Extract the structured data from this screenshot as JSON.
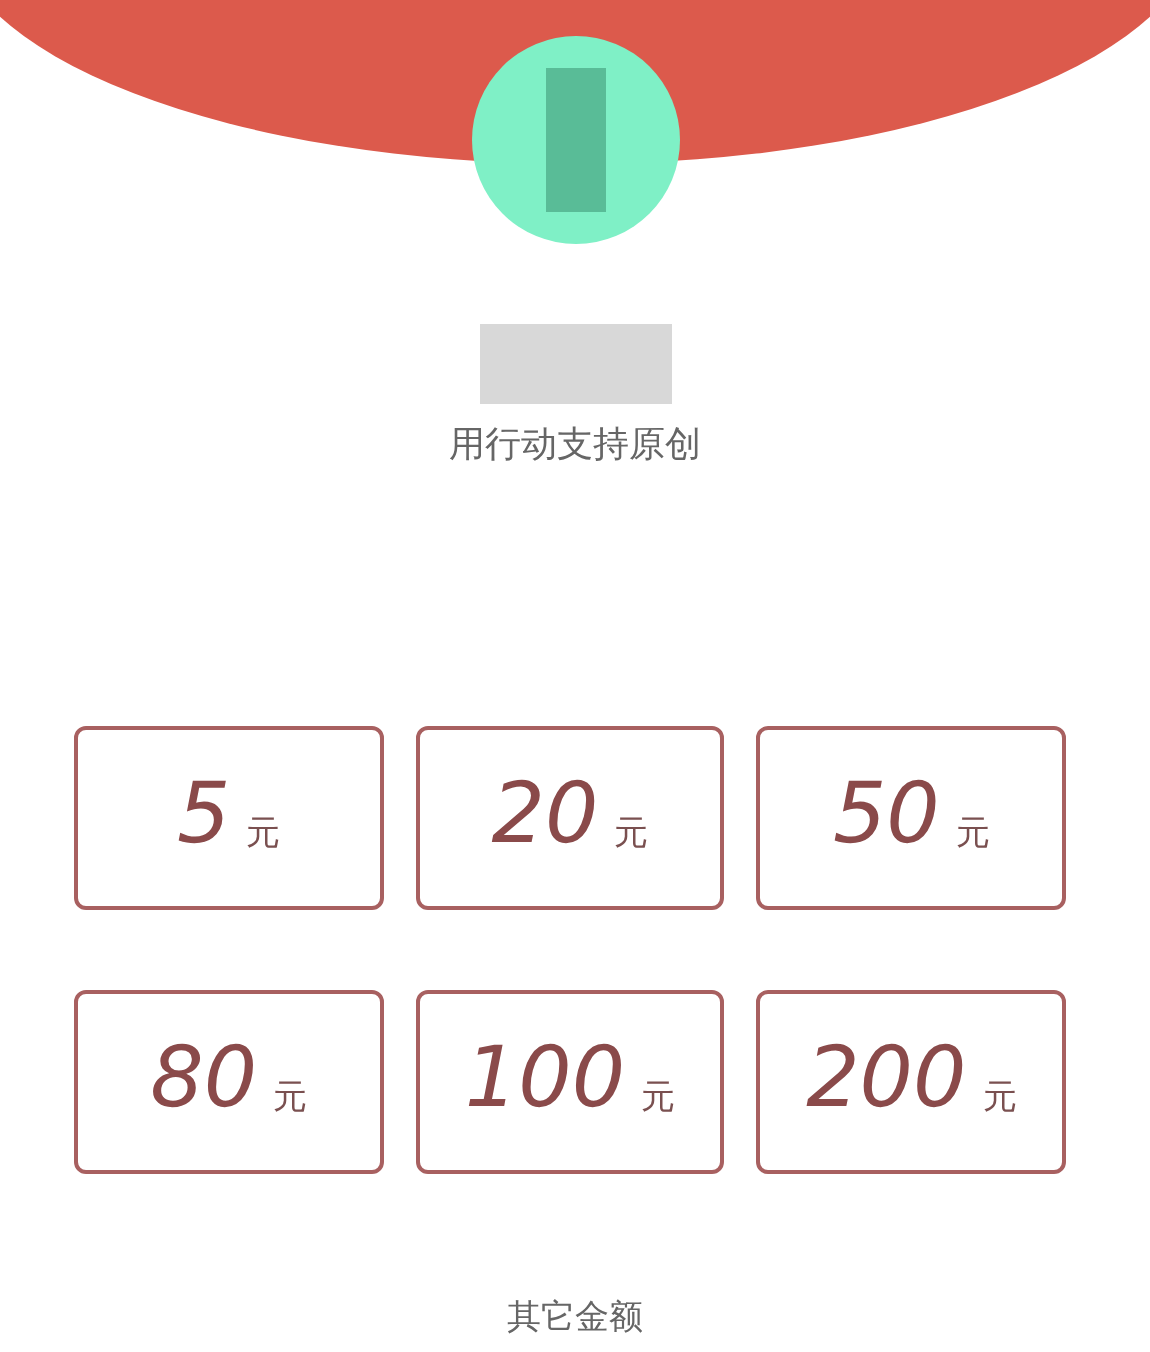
{
  "slogan": "用行动支持原创",
  "amounts": [
    {
      "value": "5",
      "unit": "元"
    },
    {
      "value": "20",
      "unit": "元"
    },
    {
      "value": "50",
      "unit": "元"
    },
    {
      "value": "80",
      "unit": "元"
    },
    {
      "value": "100",
      "unit": "元"
    },
    {
      "value": "200",
      "unit": "元"
    }
  ],
  "other_amount": "其它金额"
}
